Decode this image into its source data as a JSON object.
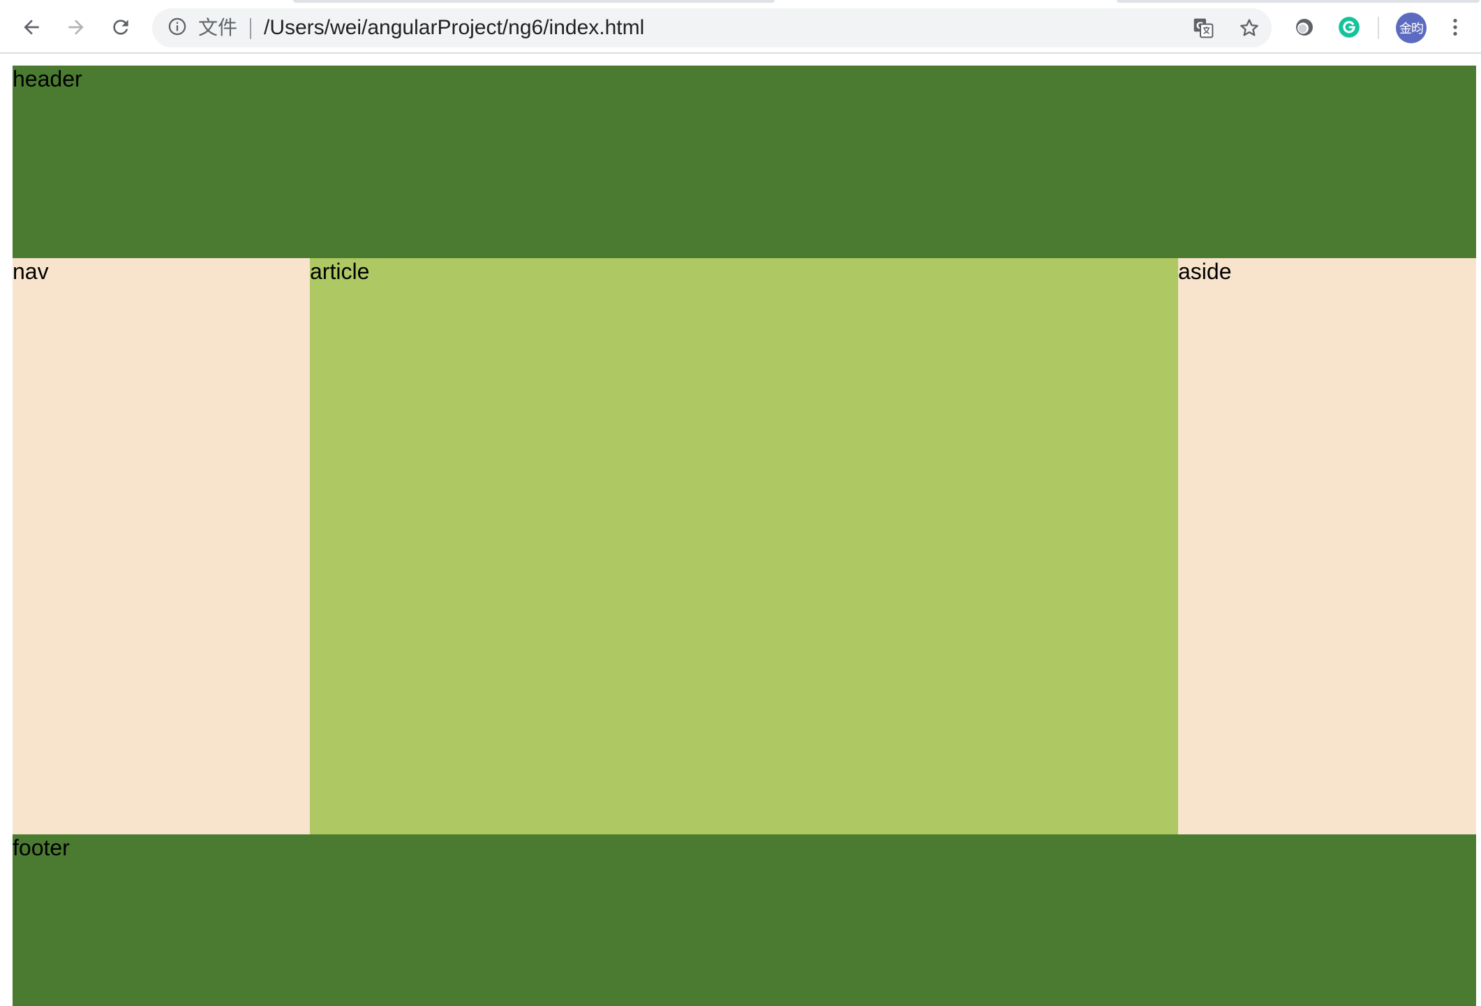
{
  "browser": {
    "address_bar": {
      "scheme_label": "文件",
      "url": "/Users/wei/angularProject/ng6/index.html"
    },
    "profile_avatar_text": "金昀"
  },
  "layout_blocks": {
    "header": {
      "label": "header",
      "color": "#4a7b30"
    },
    "nav": {
      "label": "nav",
      "color": "#f8e4cc"
    },
    "article": {
      "label": "article",
      "color": "#aec863"
    },
    "aside": {
      "label": "aside",
      "color": "#f8e4cc"
    },
    "footer": {
      "label": "footer",
      "color": "#4a7b30"
    }
  },
  "icons": {
    "back": "back-arrow-icon",
    "forward": "forward-arrow-icon",
    "reload": "reload-icon",
    "info": "info-icon",
    "translate": "translate-icon",
    "bookmark": "star-icon",
    "extension_1": "extension-circle-icon",
    "extension_2": "grammarly-icon",
    "menu": "kebab-menu-icon"
  }
}
